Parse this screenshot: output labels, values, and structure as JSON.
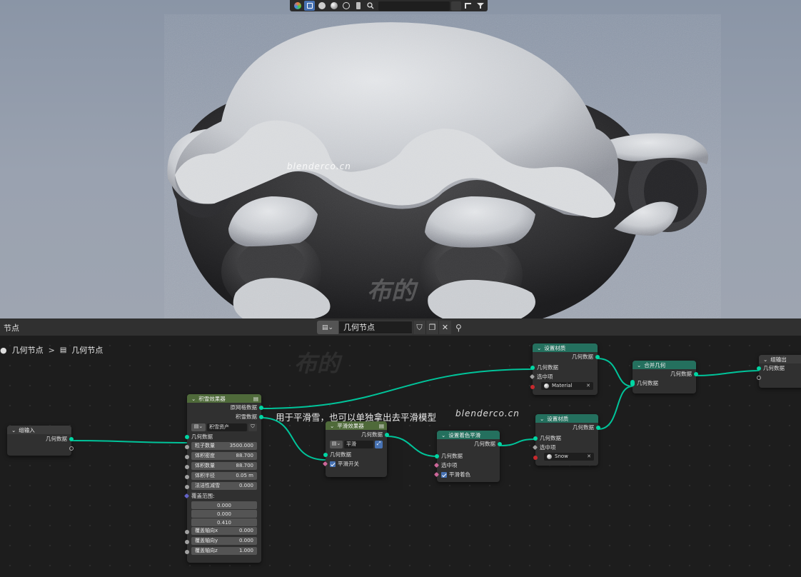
{
  "viewport": {
    "watermark_en": "blenderco.cn",
    "watermark_cn": "布的"
  },
  "editor": {
    "header_title": "节点",
    "tree_selector": {
      "name": "几何节点",
      "type_icon": "geometry-nodes-icon"
    },
    "breadcrumb": [
      "几何节点",
      "几何节点"
    ],
    "annotation": "用于平滑雪，也可以单独拿出去平滑模型",
    "watermark_en": "blenderco.cn",
    "watermark_cn": "布的"
  },
  "nodes": {
    "group_input": {
      "title": "组输入",
      "out_geometry": "几何数据"
    },
    "snow": {
      "title": "积雪效果器",
      "out_mesh": "原网格数据",
      "out_snow": "积雪数据",
      "asset_label": "积雪资产",
      "in_geometry": "几何数据",
      "fields": [
        {
          "label": "粒子数量",
          "value": "3500.000"
        },
        {
          "label": "体积密度",
          "value": "88.700"
        },
        {
          "label": "体积数量",
          "value": "88.700"
        },
        {
          "label": "体积半径",
          "value": "0.05 m"
        },
        {
          "label": "法洁性减雪",
          "value": "0.000"
        }
      ],
      "cover_label": "覆盖范围:",
      "cover_values": [
        "0.000",
        "0.000",
        "0.410"
      ],
      "axis_fields": [
        {
          "label": "覆盖轴向x",
          "value": "0.000"
        },
        {
          "label": "覆盖轴向y",
          "value": "0.000"
        },
        {
          "label": "覆盖轴向z",
          "value": "1.000"
        }
      ]
    },
    "smooth": {
      "title": "平滑效果器",
      "out_geometry": "几何数据",
      "dropdown": "平滑",
      "in_geometry": "几何数据",
      "toggle_label": "平滑开关"
    },
    "shade_smooth": {
      "title": "设置着色平滑",
      "out_geometry": "几何数据",
      "in_geometry": "几何数据",
      "selection": "选中项",
      "checkbox": "平滑着色"
    },
    "set_material_1": {
      "title": "设置材质",
      "out_geometry": "几何数据",
      "in_geometry": "几何数据",
      "selection": "选中项",
      "material": "Material"
    },
    "set_material_2": {
      "title": "设置材质",
      "out_geometry": "几何数据",
      "in_geometry": "几何数据",
      "selection": "选中项",
      "material": "Snow"
    },
    "join": {
      "title": "合并几何",
      "out_geometry": "几何数据",
      "in_geometry": "几何数据"
    },
    "group_output": {
      "title": "组输出",
      "in_geometry": "几何数据"
    }
  }
}
